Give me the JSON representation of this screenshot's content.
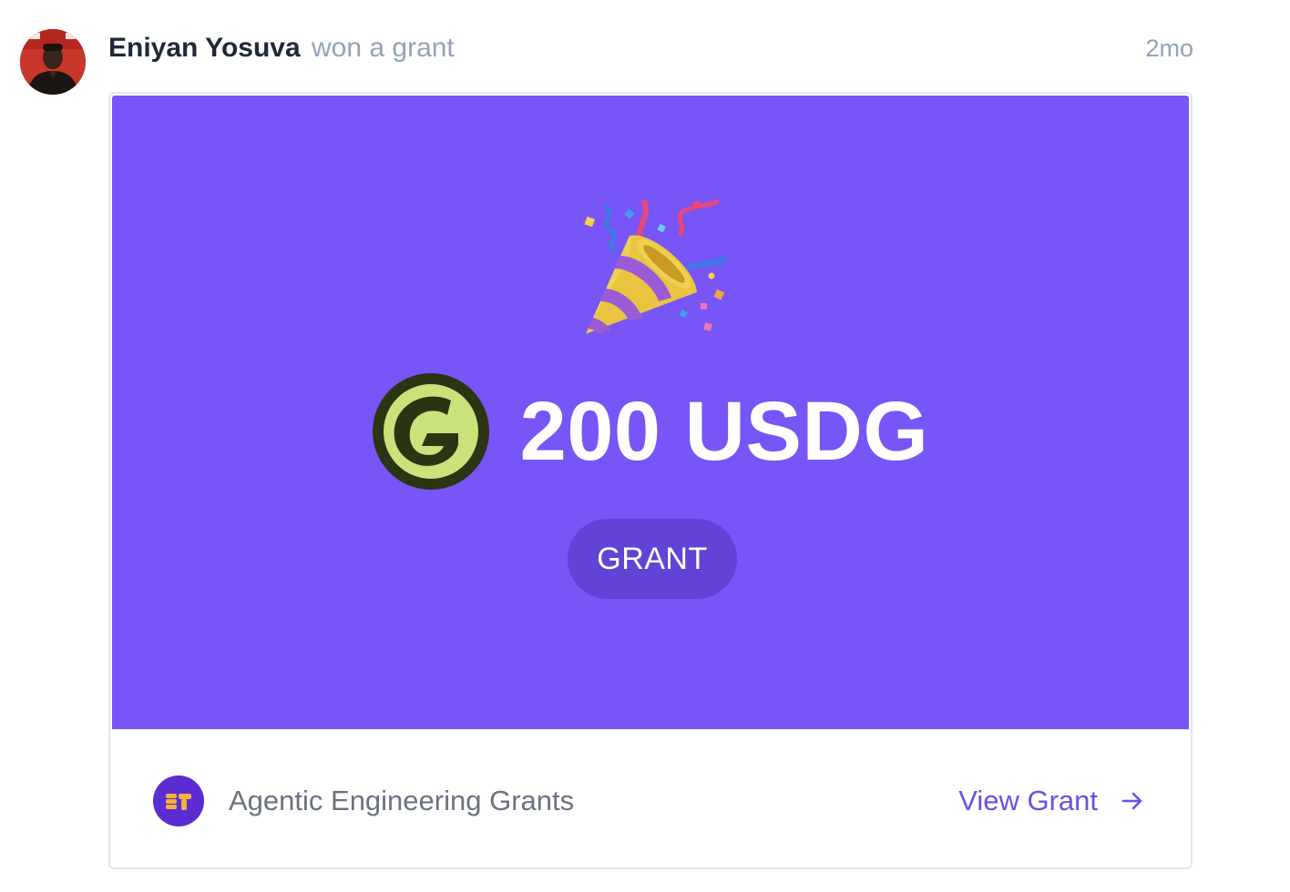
{
  "activity": {
    "user_name": "Eniyan Yosuva",
    "action": "won a grant",
    "timestamp": "2mo"
  },
  "banner": {
    "celebration_icon": "party-popper-icon",
    "token_icon": "usdg-token-icon",
    "amount": "200 USDG",
    "badge": "GRANT"
  },
  "footer": {
    "sponsor_name": "Agentic Engineering Grants",
    "link_label": "View Grant",
    "link_icon": "arrow-right-icon"
  },
  "colors": {
    "banner_bg": "#7755f6",
    "badge_bg": "#6342d6",
    "link": "#6d4ee8",
    "token_bg": "#c9e27a",
    "token_ring": "#2c3414"
  }
}
